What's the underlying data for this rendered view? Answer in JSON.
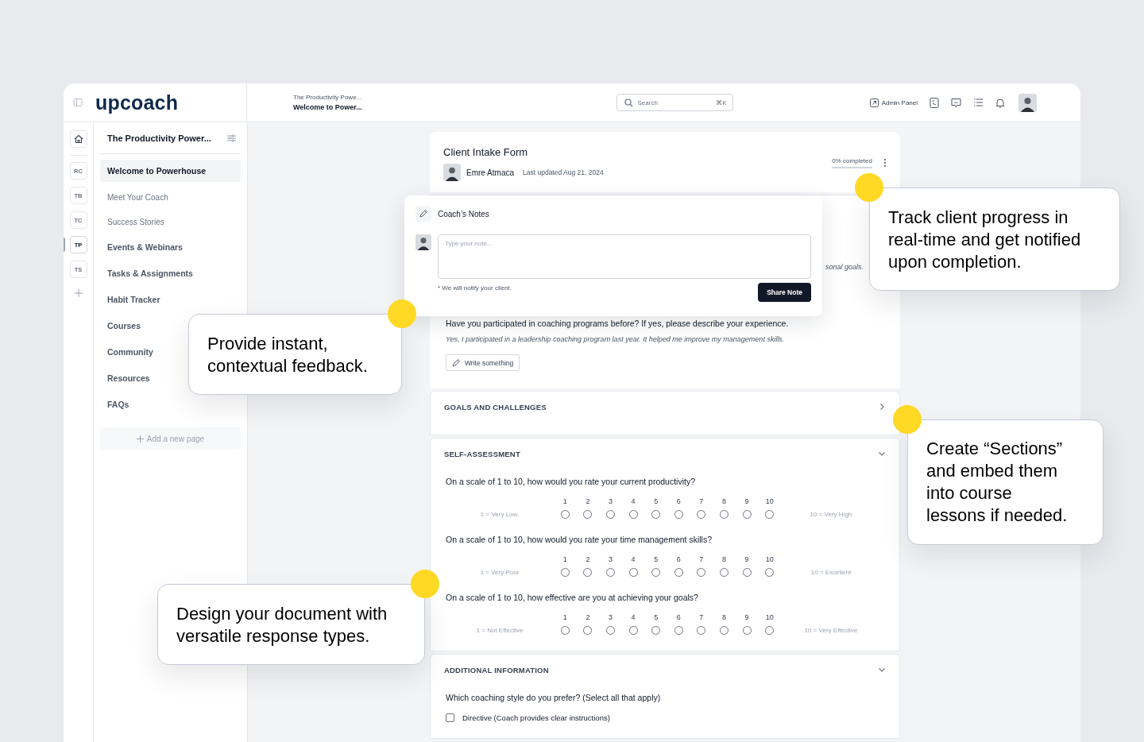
{
  "logo": "upcoach",
  "breadcrumb": {
    "parent": "The Productivity Powe...",
    "current": "Welcome to Power..."
  },
  "search": {
    "placeholder": "Search",
    "shortcut": "⌘K"
  },
  "header": {
    "admin_panel": "Admin Panel"
  },
  "rail": [
    {
      "label": "RC",
      "selected": false
    },
    {
      "label": "TB",
      "selected": false
    },
    {
      "label": "TC",
      "selected": false
    },
    {
      "label": "TP",
      "selected": true
    },
    {
      "label": "TS",
      "selected": false
    }
  ],
  "course": {
    "title": "The Productivity Power...",
    "add_page": "Add a new page",
    "pages": [
      {
        "label": "Welcome to Powerhouse",
        "kind": "page",
        "selected": true
      },
      {
        "label": "Meet Your Coach",
        "kind": "sub",
        "selected": false
      },
      {
        "label": "Success Stories",
        "kind": "sub",
        "selected": false
      },
      {
        "label": "Events & Webinars",
        "kind": "page",
        "selected": false
      },
      {
        "label": "Tasks & Assignments",
        "kind": "page",
        "selected": false
      },
      {
        "label": "Habit Tracker",
        "kind": "page",
        "selected": false
      },
      {
        "label": "Courses",
        "kind": "page",
        "selected": false
      },
      {
        "label": "Community",
        "kind": "page",
        "selected": false
      },
      {
        "label": "Resources",
        "kind": "page",
        "selected": false
      },
      {
        "label": "FAQs",
        "kind": "page",
        "selected": false
      }
    ]
  },
  "form": {
    "title": "Client Intake Form",
    "author": "Emre Atmaca",
    "updated": "Last updated Aug 21, 2024",
    "progress_label": "0% completed",
    "level": 0,
    "answer_fragment": "sonal goals.",
    "question": "Have you participated in coaching programs before? If yes, please describe your experience.",
    "answer": "Yes, I participated in a leadership coaching program last year. It helped me improve my management skills.",
    "write_button": "Write something"
  },
  "sections": [
    {
      "title": "GOALS AND CHALLENGES",
      "expanded": false
    },
    {
      "title": "SELF-ASSESSMENT",
      "expanded": true,
      "questions": [
        {
          "kind": "scale",
          "text": "On a scale of 1 to 10, how would you rate your current productivity?",
          "low": "1 = Very Low,",
          "high": "10 = Very High",
          "options": [
            {
              "label": "1",
              "selected": false
            },
            {
              "label": "2",
              "selected": false
            },
            {
              "label": "3",
              "selected": false
            },
            {
              "label": "4",
              "selected": false
            },
            {
              "label": "5",
              "selected": false
            },
            {
              "label": "6",
              "selected": false
            },
            {
              "label": "7",
              "selected": false
            },
            {
              "label": "8",
              "selected": false
            },
            {
              "label": "9",
              "selected": false
            },
            {
              "label": "10",
              "selected": false
            }
          ]
        },
        {
          "kind": "scale",
          "text": "On a scale of 1 to 10, how would you rate your time management skills?",
          "low": "1 = Very Poor",
          "high": "10 = Excellent",
          "options": [
            {
              "label": "1",
              "selected": false
            },
            {
              "label": "2",
              "selected": false
            },
            {
              "label": "3",
              "selected": false
            },
            {
              "label": "4",
              "selected": false
            },
            {
              "label": "5",
              "selected": false
            },
            {
              "label": "6",
              "selected": false
            },
            {
              "label": "7",
              "selected": false
            },
            {
              "label": "8",
              "selected": false
            },
            {
              "label": "9",
              "selected": false
            },
            {
              "label": "10",
              "selected": false
            }
          ]
        },
        {
          "kind": "scale",
          "text": "On a scale of 1 to 10, how effective are you at achieving your goals?",
          "low": "1 = Not Effective",
          "high": "10 = Very Effective",
          "options": [
            {
              "label": "1",
              "selected": false
            },
            {
              "label": "2",
              "selected": false
            },
            {
              "label": "3",
              "selected": false
            },
            {
              "label": "4",
              "selected": false
            },
            {
              "label": "5",
              "selected": false
            },
            {
              "label": "6",
              "selected": false
            },
            {
              "label": "7",
              "selected": false
            },
            {
              "label": "8",
              "selected": false
            },
            {
              "label": "9",
              "selected": false
            },
            {
              "label": "10",
              "selected": false
            }
          ]
        }
      ]
    },
    {
      "title": "ADDITIONAL INFORMATION",
      "expanded": true,
      "questions": [
        {
          "kind": "checkbox",
          "text": "Which coaching style do you prefer? (Select all that apply)",
          "options": [
            {
              "label": "Directive (Coach provides clear instructions)",
              "checked": false
            }
          ]
        }
      ]
    }
  ],
  "coach_notes": {
    "title": "Coach’s Notes",
    "placeholder": "Type your note...",
    "hint": "* We will notify your client.",
    "button": "Share Note"
  },
  "callouts": [
    {
      "text": "Track client progress in real-time and get notified upon completion."
    },
    {
      "text": "Provide instant, contextual feedback."
    },
    {
      "text": "Create “Sections” and embed them into course lessons if needed."
    },
    {
      "text": "Design your document with versatile response types."
    }
  ]
}
